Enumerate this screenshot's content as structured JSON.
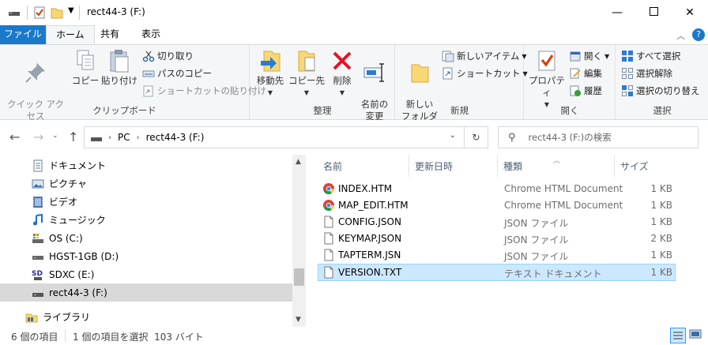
{
  "window": {
    "title": "rect44-3 (F:)"
  },
  "tabs": {
    "file": "ファイル",
    "home": "ホーム",
    "share": "共有",
    "view": "表示"
  },
  "ribbon": {
    "clipboard": {
      "pin": "クイック アクセス\nにピン留めする",
      "copy": "コピー",
      "paste": "貼り付け",
      "cut": "切り取り",
      "copy_path": "パスのコピー",
      "paste_shortcut": "ショートカットの貼り付け",
      "label": "クリップボード"
    },
    "organize": {
      "move_to": "移動先",
      "copy_to": "コピー先",
      "delete": "削除",
      "rename": "名前の\n変更",
      "label": "整理"
    },
    "new": {
      "new_folder": "新しい\nフォルダー",
      "new_item": "新しいアイテム",
      "easy_access": "ショートカット",
      "label": "新規"
    },
    "open": {
      "properties": "プロパティ",
      "open": "開く",
      "edit": "編集",
      "history": "履歴",
      "label": "開く"
    },
    "select": {
      "select_all": "すべて選択",
      "select_none": "選択解除",
      "invert": "選択の切り替え",
      "label": "選択"
    }
  },
  "address": {
    "crumbs": [
      "PC",
      "rect44-3 (F:)"
    ],
    "search_placeholder": "rect44-3 (F:)の検索"
  },
  "nav": {
    "items": [
      {
        "label": "ドキュメント",
        "icon": "documents-icon"
      },
      {
        "label": "ピクチャ",
        "icon": "pictures-icon"
      },
      {
        "label": "ビデオ",
        "icon": "videos-icon"
      },
      {
        "label": "ミュージック",
        "icon": "music-icon"
      },
      {
        "label": "OS (C:)",
        "icon": "os-drive-icon"
      },
      {
        "label": "HGST-1GB (D:)",
        "icon": "drive-icon"
      },
      {
        "label": "SDXC (E:)",
        "icon": "sd-card-icon"
      },
      {
        "label": "rect44-3 (F:)",
        "icon": "usb-drive-icon"
      },
      {
        "label": "ライブラリ",
        "icon": "library-icon"
      }
    ]
  },
  "files": {
    "columns": {
      "name": "名前",
      "date": "更新日時",
      "type": "種類",
      "size": "サイズ"
    },
    "rows": [
      {
        "name": "INDEX.HTM",
        "type": "Chrome HTML Document",
        "size": "1 KB",
        "icon": "chrome-icon"
      },
      {
        "name": "MAP_EDIT.HTM",
        "type": "Chrome HTML Document",
        "size": "1 KB",
        "icon": "chrome-icon"
      },
      {
        "name": "CONFIG.JSON",
        "type": "JSON ファイル",
        "size": "1 KB",
        "icon": "file-icon"
      },
      {
        "name": "KEYMAP.JSON",
        "type": "JSON ファイル",
        "size": "2 KB",
        "icon": "file-icon"
      },
      {
        "name": "TAPTERM.JSN",
        "type": "JSON ファイル",
        "size": "1 KB",
        "icon": "file-icon"
      },
      {
        "name": "VERSION.TXT",
        "type": "テキスト ドキュメント",
        "size": "1 KB",
        "icon": "file-icon"
      }
    ]
  },
  "status": {
    "count": "6 個の項目",
    "selection": "1 個の項目を選択  103 バイト"
  },
  "colors": {
    "file_tab": "#1979ca",
    "selection": "#cce8ff",
    "nav_selection": "#d9d9d9"
  }
}
